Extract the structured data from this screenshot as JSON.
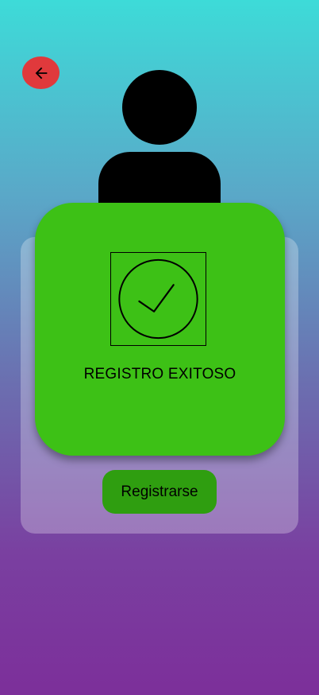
{
  "header": {
    "back_icon": "arrow-left-icon"
  },
  "avatar": {
    "icon": "user-silhouette-icon"
  },
  "success_dialog": {
    "icon": "check-circle-icon",
    "message": "REGISTRO EXITOSO"
  },
  "form": {
    "register_label": "Registrarse"
  },
  "colors": {
    "back_button": "#e0393c",
    "success_card": "#3dc116",
    "register_button": "#2f9e10"
  }
}
